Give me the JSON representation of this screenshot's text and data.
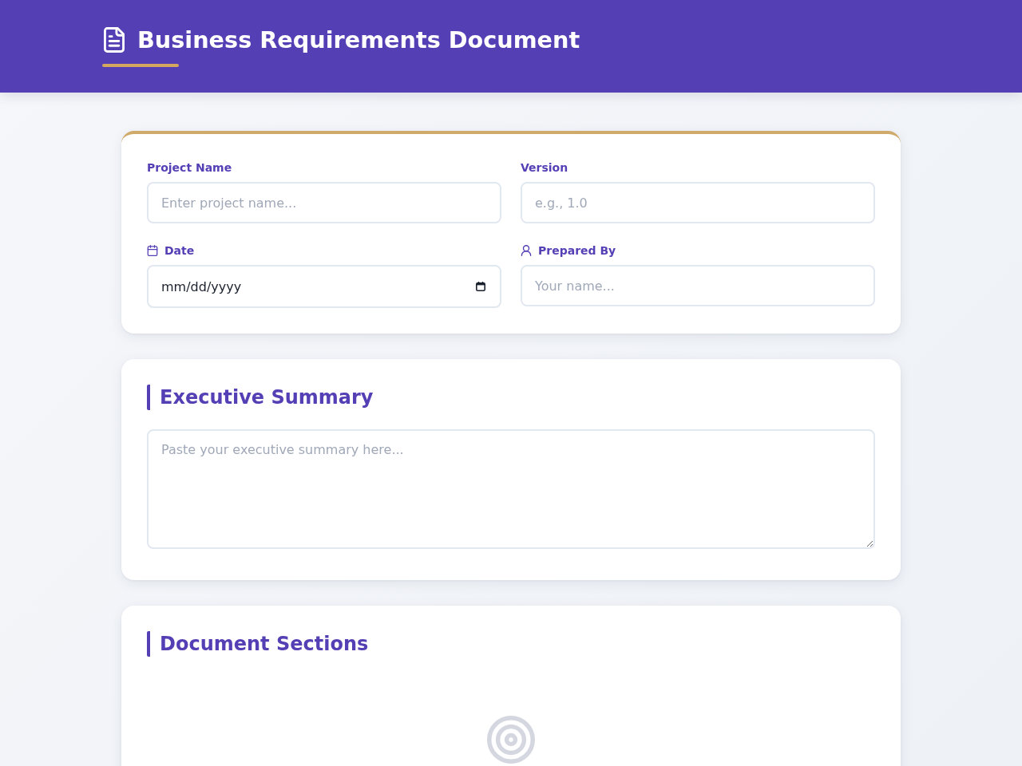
{
  "header": {
    "title": "Business Requirements Document"
  },
  "project_details": {
    "fields": [
      {
        "kind": "text",
        "label": "Project Name",
        "placeholder": "Enter project name..."
      },
      {
        "kind": "text",
        "label": "Version",
        "placeholder": "e.g., 1.0"
      },
      {
        "kind": "date",
        "label": "Date",
        "value": "mm/dd/yyyy"
      },
      {
        "kind": "person",
        "label": "Prepared By",
        "placeholder": "Your name..."
      }
    ]
  },
  "executive_summary": {
    "title": "Executive Summary",
    "placeholder": "Paste your executive summary here..."
  },
  "document_sections": {
    "title": "Document Sections"
  }
}
